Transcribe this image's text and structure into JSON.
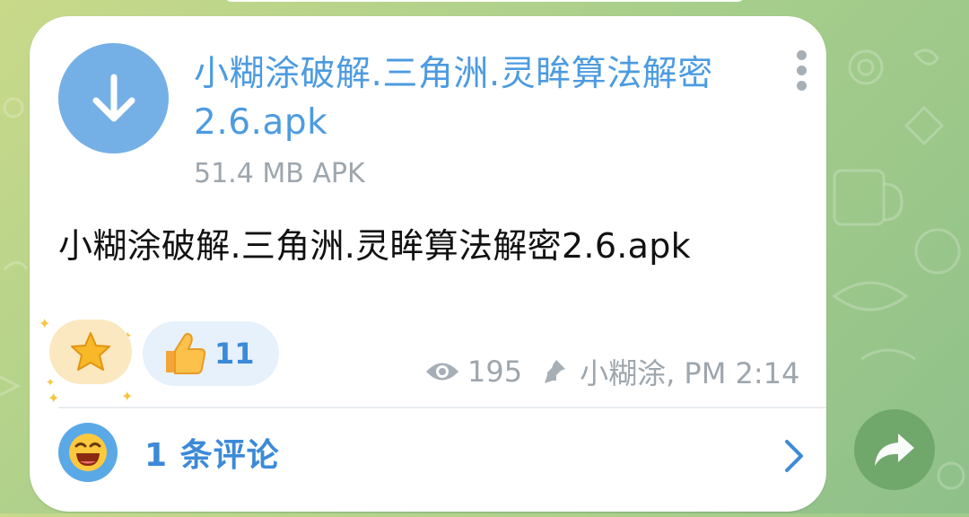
{
  "message": {
    "file": {
      "name": "小糊涂破解.三角洲.灵眸算法解密2.6.apk",
      "size_type": "51.4 MB APK",
      "icon": "download-arrow-icon"
    },
    "caption": "小糊涂破解.三角洲.灵眸算法解密2.6.apk",
    "reactions": [
      {
        "emoji": "star-icon",
        "count": ""
      },
      {
        "emoji": "thumbs-up-icon",
        "count": "11"
      }
    ],
    "views": "195",
    "author_time": "小糊涂, PM 2:14",
    "comments_label": "1 条评论"
  },
  "colors": {
    "accent": "#4d9be0",
    "bubble": "#ffffff",
    "meta": "#9ea6ad",
    "share_button": "#6fa66a"
  }
}
